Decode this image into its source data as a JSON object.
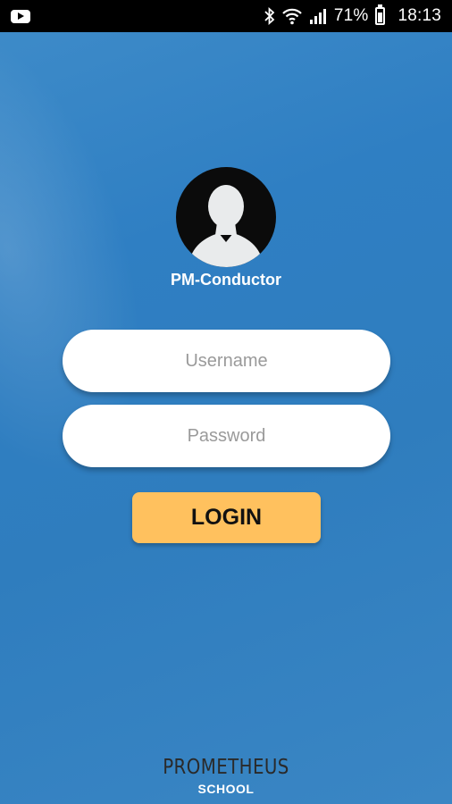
{
  "status_bar": {
    "battery_percent": "71%",
    "time": "18:13",
    "icons": [
      "youtube-icon",
      "bluetooth-icon",
      "wifi-icon",
      "signal-icon",
      "battery-icon"
    ]
  },
  "profile": {
    "app_name": "PM-Conductor",
    "avatar_icon": "user-silhouette-icon"
  },
  "form": {
    "username_placeholder": "Username",
    "password_placeholder": "Password",
    "login_label": "LOGIN"
  },
  "brand": {
    "title": "PROMETHEUS",
    "subtitle": "SCHOOL"
  },
  "colors": {
    "background": "#2f7fc3",
    "login_button": "#ffc15e",
    "status_bar": "#000000"
  }
}
